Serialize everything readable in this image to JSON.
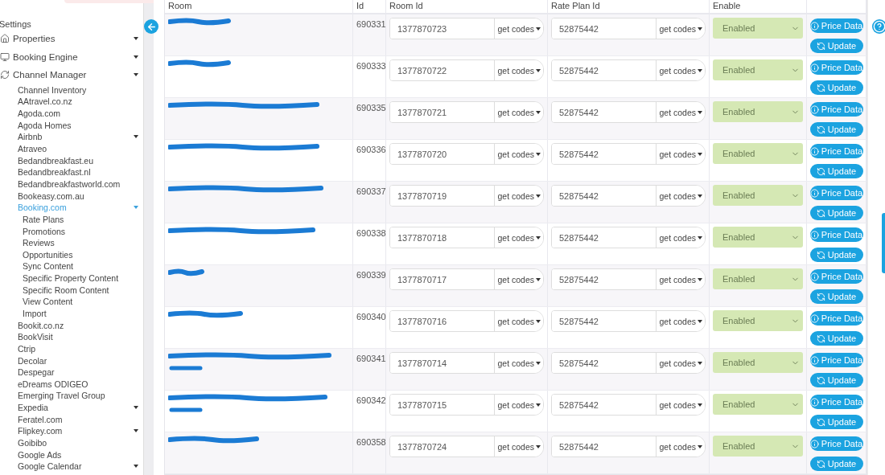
{
  "sidebar": {
    "title": "Settings",
    "items": [
      {
        "label": "Properties",
        "kind": "group",
        "selected": false
      },
      {
        "label": "Booking Engine",
        "kind": "group",
        "selected": false
      },
      {
        "label": "Channel Manager",
        "kind": "group",
        "selected": false,
        "children": [
          {
            "label": "Channel Inventory",
            "kind": "link",
            "selected": false
          },
          {
            "label": "AAtravel.co.nz",
            "kind": "link",
            "selected": false
          },
          {
            "label": "Agoda.com",
            "kind": "link",
            "selected": false
          },
          {
            "label": "Agoda Homes",
            "kind": "link",
            "selected": false
          },
          {
            "label": "Airbnb",
            "kind": "group",
            "selected": false
          },
          {
            "label": "Atraveo",
            "kind": "link",
            "selected": false
          },
          {
            "label": "Bedandbreakfast.eu",
            "kind": "link",
            "selected": false
          },
          {
            "label": "Bedandbreakfast.nl",
            "kind": "link",
            "selected": false
          },
          {
            "label": "Bedandbreakfastworld.com",
            "kind": "link",
            "selected": false
          },
          {
            "label": "Bookeasy.com.au",
            "kind": "link",
            "selected": false
          },
          {
            "label": "Booking.com",
            "kind": "group",
            "selected": true,
            "children": [
              {
                "label": "Rate Plans",
                "kind": "link",
                "selected": false
              },
              {
                "label": "Promotions",
                "kind": "link",
                "selected": false
              },
              {
                "label": "Reviews",
                "kind": "link",
                "selected": false
              },
              {
                "label": "Opportunities",
                "kind": "link",
                "selected": false
              },
              {
                "label": "Sync Content",
                "kind": "link",
                "selected": false
              },
              {
                "label": "Specific Property Content",
                "kind": "link",
                "selected": false
              },
              {
                "label": "Specific Room Content",
                "kind": "link",
                "selected": false
              },
              {
                "label": "View Content",
                "kind": "link",
                "selected": false
              },
              {
                "label": "Import",
                "kind": "link",
                "selected": false
              }
            ]
          },
          {
            "label": "Bookit.co.nz",
            "kind": "link",
            "selected": false
          },
          {
            "label": "BookVisit",
            "kind": "link",
            "selected": false
          },
          {
            "label": "Ctrip",
            "kind": "link",
            "selected": false
          },
          {
            "label": "Decolar",
            "kind": "link",
            "selected": false
          },
          {
            "label": "Despegar",
            "kind": "link",
            "selected": false
          },
          {
            "label": "eDreams ODIGEO",
            "kind": "link",
            "selected": false
          },
          {
            "label": "Emerging Travel Group",
            "kind": "link",
            "selected": false
          },
          {
            "label": "Expedia",
            "kind": "group",
            "selected": false
          },
          {
            "label": "Feratel.com",
            "kind": "link",
            "selected": false
          },
          {
            "label": "Flipkey.com",
            "kind": "group",
            "selected": false
          },
          {
            "label": "Goibibo",
            "kind": "link",
            "selected": false
          },
          {
            "label": "Google Ads",
            "kind": "link",
            "selected": false
          },
          {
            "label": "Google Calendar",
            "kind": "group",
            "selected": false
          }
        ]
      }
    ]
  },
  "table": {
    "columns": [
      "Room",
      "Id",
      "Room Id",
      "Rate Plan Id",
      "Enable"
    ],
    "rows": [
      {
        "id": "690331",
        "room_id": "1377870723",
        "room_codes": "get codes",
        "rate_plan_id": "52875442",
        "rate_codes": "get codes",
        "enable": "Enabled",
        "enabled": true,
        "price": "Price Data",
        "update": "Update"
      },
      {
        "id": "690333",
        "room_id": "1377870722",
        "room_codes": "get codes",
        "rate_plan_id": "52875442",
        "rate_codes": "get codes",
        "enable": "Enabled",
        "enabled": true,
        "price": "Price Data",
        "update": "Update"
      },
      {
        "id": "690335",
        "room_id": "1377870721",
        "room_codes": "get codes",
        "rate_plan_id": "52875442",
        "rate_codes": "get codes",
        "enable": "Enabled",
        "enabled": true,
        "price": "Price Data",
        "update": "Update"
      },
      {
        "id": "690336",
        "room_id": "1377870720",
        "room_codes": "get codes",
        "rate_plan_id": "52875442",
        "rate_codes": "get codes",
        "enable": "Enabled",
        "enabled": true,
        "price": "Price Data",
        "update": "Update"
      },
      {
        "id": "690337",
        "room_id": "1377870719",
        "room_codes": "get codes",
        "rate_plan_id": "52875442",
        "rate_codes": "get codes",
        "enable": "Enabled",
        "enabled": true,
        "price": "Price Data",
        "update": "Update"
      },
      {
        "id": "690338",
        "room_id": "1377870718",
        "room_codes": "get codes",
        "rate_plan_id": "52875442",
        "rate_codes": "get codes",
        "enable": "Enabled",
        "enabled": true,
        "price": "Price Data",
        "update": "Update"
      },
      {
        "id": "690339",
        "room_id": "1377870717",
        "room_codes": "get codes",
        "rate_plan_id": "52875442",
        "rate_codes": "get codes",
        "enable": "Enabled",
        "enabled": true,
        "price": "Price Data",
        "update": "Update"
      },
      {
        "id": "690340",
        "room_id": "1377870716",
        "room_codes": "get codes",
        "rate_plan_id": "52875442",
        "rate_codes": "get codes",
        "enable": "Enabled",
        "enabled": true,
        "price": "Price Data",
        "update": "Update"
      },
      {
        "id": "690341",
        "room_id": "1377870714",
        "room_codes": "get codes",
        "rate_plan_id": "52875442",
        "rate_codes": "get codes",
        "enable": "Enabled",
        "enabled": true,
        "price": "Price Data",
        "update": "Update"
      },
      {
        "id": "690342",
        "room_id": "1377870715",
        "room_codes": "get codes",
        "rate_plan_id": "52875442",
        "rate_codes": "get codes",
        "enable": "Enabled",
        "enabled": true,
        "price": "Price Data",
        "update": "Update"
      },
      {
        "id": "690358",
        "room_id": "1377870724",
        "room_codes": "get codes",
        "rate_plan_id": "52875442",
        "rate_codes": "get codes",
        "enable": "Enabled",
        "enabled": true,
        "price": "Price Data",
        "update": "Update"
      }
    ]
  }
}
